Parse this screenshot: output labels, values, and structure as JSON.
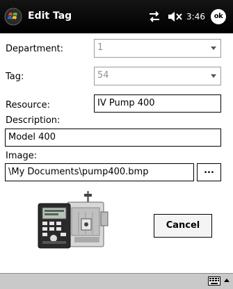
{
  "title_bar": {
    "title": "Edit Tag",
    "time": "3:46",
    "ok_label": "ok"
  },
  "form": {
    "department": {
      "label": "Department:",
      "value": "1"
    },
    "tag": {
      "label": "Tag:",
      "value": "54"
    },
    "resource": {
      "label": "Resource:",
      "value": "IV Pump 400"
    },
    "description": {
      "label": "Description:",
      "value": "Model 400"
    },
    "image": {
      "label": "Image:",
      "value": "\\My Documents\\pump400.bmp",
      "browse_label": "..."
    }
  },
  "buttons": {
    "cancel_label": "Cancel"
  },
  "icons": {
    "start": "windows-flag-icon",
    "connectivity": "connectivity-arrows-icon",
    "volume": "speaker-muted-icon",
    "keyboard": "keyboard-icon",
    "sip": "sip-arrow-icon"
  },
  "colors": {
    "title_bar": "#000000",
    "menu_bar": "#c9c9c9",
    "disabled_text": "#909090"
  }
}
